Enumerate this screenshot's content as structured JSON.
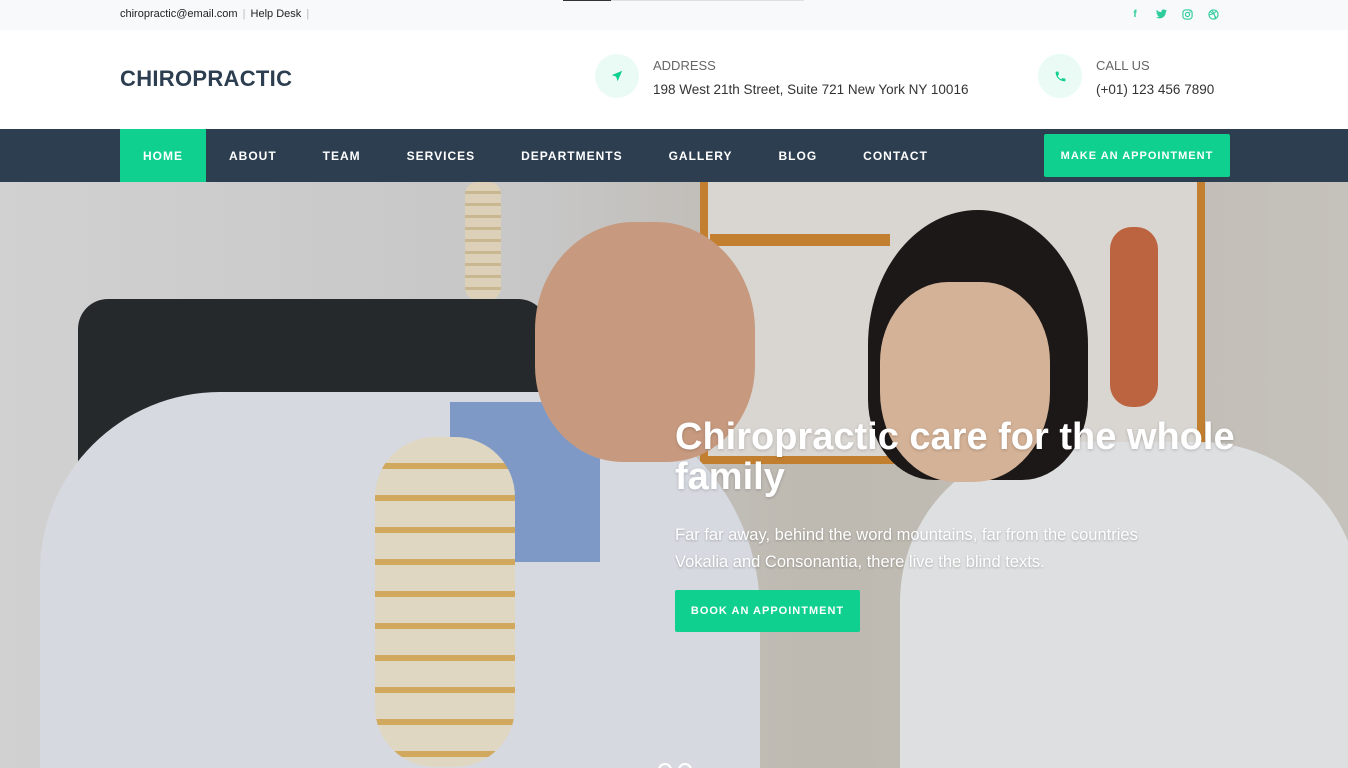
{
  "topbar": {
    "email": "chiropractic@email.com",
    "separator": "|",
    "help_desk": "Help Desk",
    "social": [
      "facebook-icon",
      "twitter-icon",
      "instagram-icon",
      "dribbble-icon"
    ]
  },
  "header": {
    "brand": "CHIROPRACTIC",
    "address_label": "ADDRESS",
    "address_value": "198 West 21th Street, Suite 721 New York NY 10016",
    "call_label": "CALL US",
    "call_value": "(+01) 123 456 7890"
  },
  "nav": {
    "items": [
      {
        "label": "HOME"
      },
      {
        "label": "ABOUT"
      },
      {
        "label": "TEAM"
      },
      {
        "label": "SERVICES"
      },
      {
        "label": "DEPARTMENTS"
      },
      {
        "label": "GALLERY"
      },
      {
        "label": "BLOG"
      },
      {
        "label": "CONTACT"
      }
    ],
    "active": "HOME",
    "cta_label": "MAKE AN APPOINTMENT"
  },
  "hero": {
    "title": "Chiropractic care for the whole family",
    "text": "Far far away, behind the word mountains, far from the countries Vokalia and Consonantia, there live the blind texts.",
    "button_label": "BOOK AN APPOINTMENT"
  },
  "colors": {
    "accent": "#0fd08f",
    "nav_bg": "#2c3e50",
    "brand_text": "#2c3e50"
  }
}
